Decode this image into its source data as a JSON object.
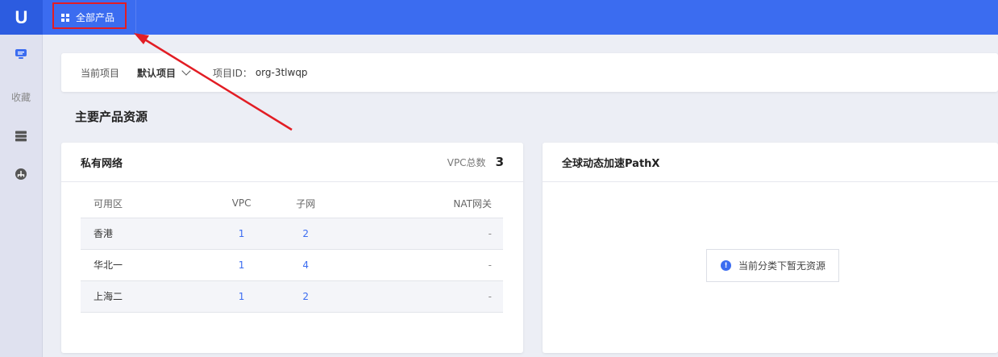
{
  "topbar": {
    "logo_text": "U",
    "all_products_label": "全部产品",
    "all_products_icon": "grid-icon",
    "highlight_color": "#e21d24"
  },
  "sidebar": {
    "items": [
      {
        "icon": "monitor-icon"
      },
      {
        "label": "收藏"
      },
      {
        "icon": "server-icon"
      },
      {
        "icon": "network-icon"
      }
    ]
  },
  "project_bar": {
    "current_project_label": "当前项目",
    "project_name": "默认项目",
    "project_id_label": "项目ID：",
    "project_id": "org-3tlwqp"
  },
  "section_title": "主要产品资源",
  "vpc_card": {
    "title": "私有网络",
    "total_label": "VPC总数",
    "total_value": "3",
    "columns": [
      "可用区",
      "VPC",
      "子网",
      "NAT网关"
    ],
    "rows": [
      {
        "zone": "香港",
        "vpc": "1",
        "subnet": "2",
        "nat": "-"
      },
      {
        "zone": "华北一",
        "vpc": "1",
        "subnet": "4",
        "nat": "-"
      },
      {
        "zone": "上海二",
        "vpc": "1",
        "subnet": "2",
        "nat": "-"
      }
    ]
  },
  "pathx_card": {
    "title": "全球动态加速PathX",
    "empty_text": "当前分类下暂无资源",
    "empty_icon": "info-icon"
  },
  "colors": {
    "brand": "#3b6cf0",
    "annotation": "#e21d24"
  }
}
